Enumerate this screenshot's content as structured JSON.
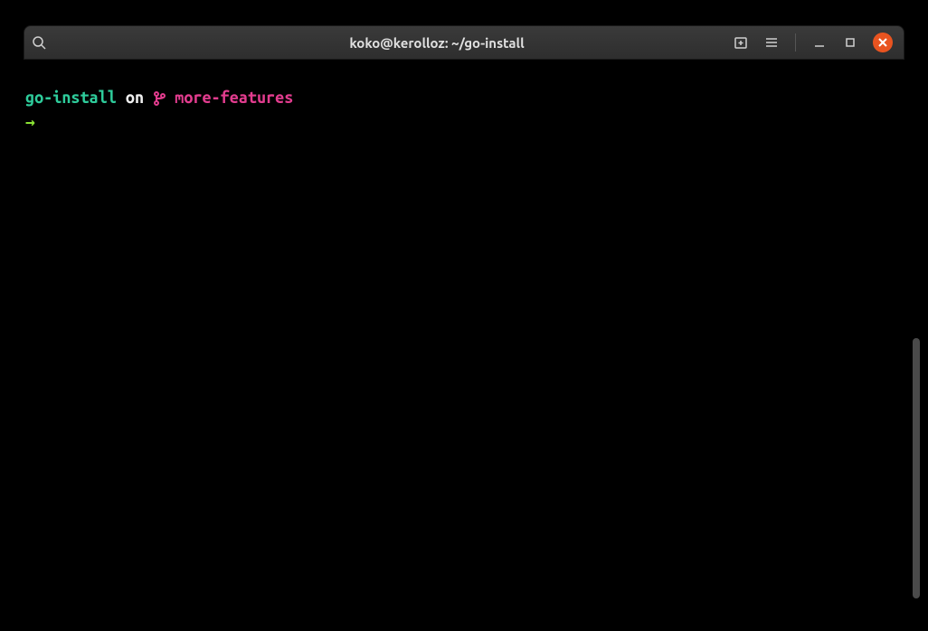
{
  "titlebar": {
    "title": "koko@kerolloz: ~/go-install"
  },
  "prompt": {
    "directory": "go-install",
    "on": " on ",
    "branch_glyph": "",
    "branch": "more-features"
  },
  "arrow": "→",
  "icons": {
    "search": "search-icon",
    "newtab": "newtab-icon",
    "hamburger": "hamburger-icon",
    "minimize": "minimize-icon",
    "maximize": "maximize-icon",
    "close": "close-icon"
  }
}
